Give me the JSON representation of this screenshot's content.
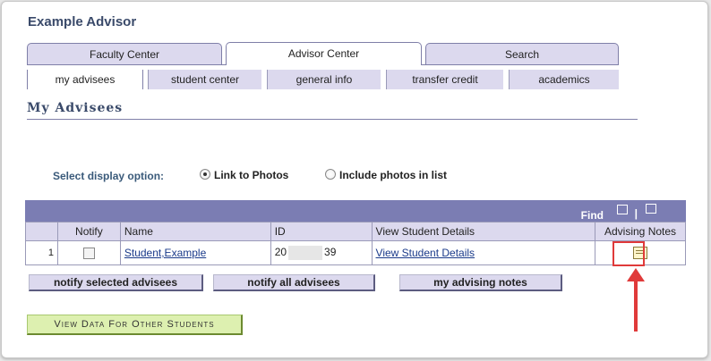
{
  "page": {
    "title": "Example Advisor"
  },
  "tabs": [
    "Faculty Center",
    "Advisor Center",
    "Search"
  ],
  "subtabs": [
    "my advisees",
    "student center",
    "general info",
    "transfer credit",
    "academics"
  ],
  "section_title": "My Advisees",
  "display_option": {
    "label": "Select display option:",
    "options": [
      "Link to Photos",
      "Include photos in list"
    ],
    "selected": "Link to Photos"
  },
  "grid": {
    "find": "Find",
    "separator": "|",
    "columns": [
      "",
      "Notify",
      "Name",
      "ID",
      "View Student Details",
      "Advising Notes"
    ],
    "rows": [
      {
        "num": "1",
        "name": "Student,Example",
        "id_start": "20",
        "id_end": "39",
        "details": "View Student Details"
      }
    ]
  },
  "buttons": {
    "notify_selected": "notify selected advisees",
    "notify_all": "notify all advisees",
    "advising_notes": "my advising notes",
    "other_students": "View Data For Other Students"
  },
  "colors": {
    "header": "#7b7db3",
    "tab": "#dcd9ee",
    "annotation": "#e03a3a",
    "green_button": "#ddf0b0"
  }
}
